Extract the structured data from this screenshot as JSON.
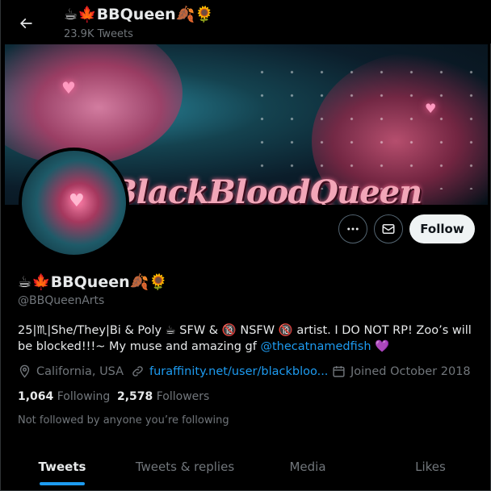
{
  "header": {
    "name": "☕🍁BBQueen🍂🌻",
    "tweet_count": "23.9K Tweets"
  },
  "banner": {
    "title": "BlackBloodQueen"
  },
  "actions": {
    "follow_label": "Follow"
  },
  "profile": {
    "display_name": "☕🍁BBQueen🍂🌻",
    "handle": "@BBQueenArts",
    "bio_text": "25|♏|She/They|Bi & Poly ☕ SFW & 🔞 NSFW 🔞 artist. I DO NOT RP! Zoo’s will be blocked!!!~ My muse and amazing gf ",
    "bio_mention": "@thecatnamedfish",
    "bio_suffix": " 💜",
    "location": "California, USA",
    "website": "furaffinity.net/user/blackbloo...",
    "joined": "Joined October 2018",
    "following_count": "1,064",
    "following_label": "Following",
    "followers_count": "2,578",
    "followers_label": "Followers",
    "not_followed_text": "Not followed by anyone you’re following"
  },
  "tabs": [
    {
      "label": "Tweets",
      "active": true
    },
    {
      "label": "Tweets & replies",
      "active": false
    },
    {
      "label": "Media",
      "active": false
    },
    {
      "label": "Likes",
      "active": false
    }
  ],
  "colors": {
    "accent": "#1d9bf0",
    "background": "#000000",
    "secondary_text": "#71767b"
  }
}
